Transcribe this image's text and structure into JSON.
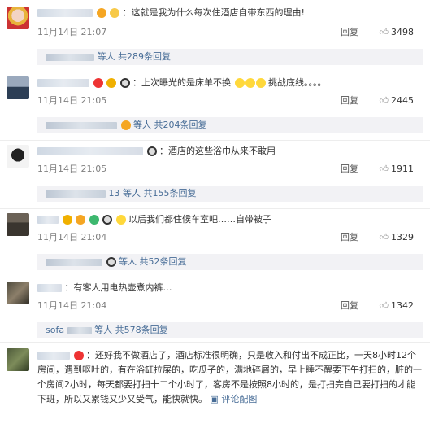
{
  "comments": [
    {
      "text": "：这就是我为什么每次住酒店自带东西的理由!",
      "time": "11月14日 21:07",
      "reply": "回复",
      "likes": "3498",
      "thread_suffix": "等人 共289条回复"
    },
    {
      "text": "：上次曝光的是床单不换",
      "text2": "挑战底线。。。。",
      "time": "11月14日 21:05",
      "reply": "回复",
      "likes": "2445",
      "thread_suffix": "等人 共204条回复"
    },
    {
      "text": "：酒店的这些浴巾从来不敢用",
      "time": "11月14日 21:05",
      "reply": "回复",
      "likes": "1911",
      "thread_prefix": "13",
      "thread_suffix": "等人 共155条回复"
    },
    {
      "text": "以后我们都住候车室吧……自带被子",
      "time": "11月14日 21:04",
      "reply": "回复",
      "likes": "1329",
      "thread_suffix": "等人 共52条回复"
    },
    {
      "text": "：有客人用电热壶煮内裤…",
      "time": "11月14日 21:04",
      "reply": "回复",
      "likes": "1342",
      "thread_prefix": "sofa",
      "thread_suffix": "等人 共578条回复"
    },
    {
      "text": "：还好我不做酒店了，酒店标准很明确，只是收入和付出不成正比，一天8小时12个房间，遇到呕吐的，有在浴缸拉屎的，吃瓜子的，满地碎屑的，早上睡不醒要下午打扫的，脏的一个房间2小时，每天都要打扫十二个小时了，客房不是按照8小时的，是打扫完自己要打扫的才能下班，所以又累钱又少又受气，能快就快。",
      "comment_link": "评论配图",
      "comment_icon": "image-icon"
    }
  ],
  "colors": {
    "link": "#486d97",
    "reply_bg": "#f2f2f5",
    "meta": "#808080"
  }
}
